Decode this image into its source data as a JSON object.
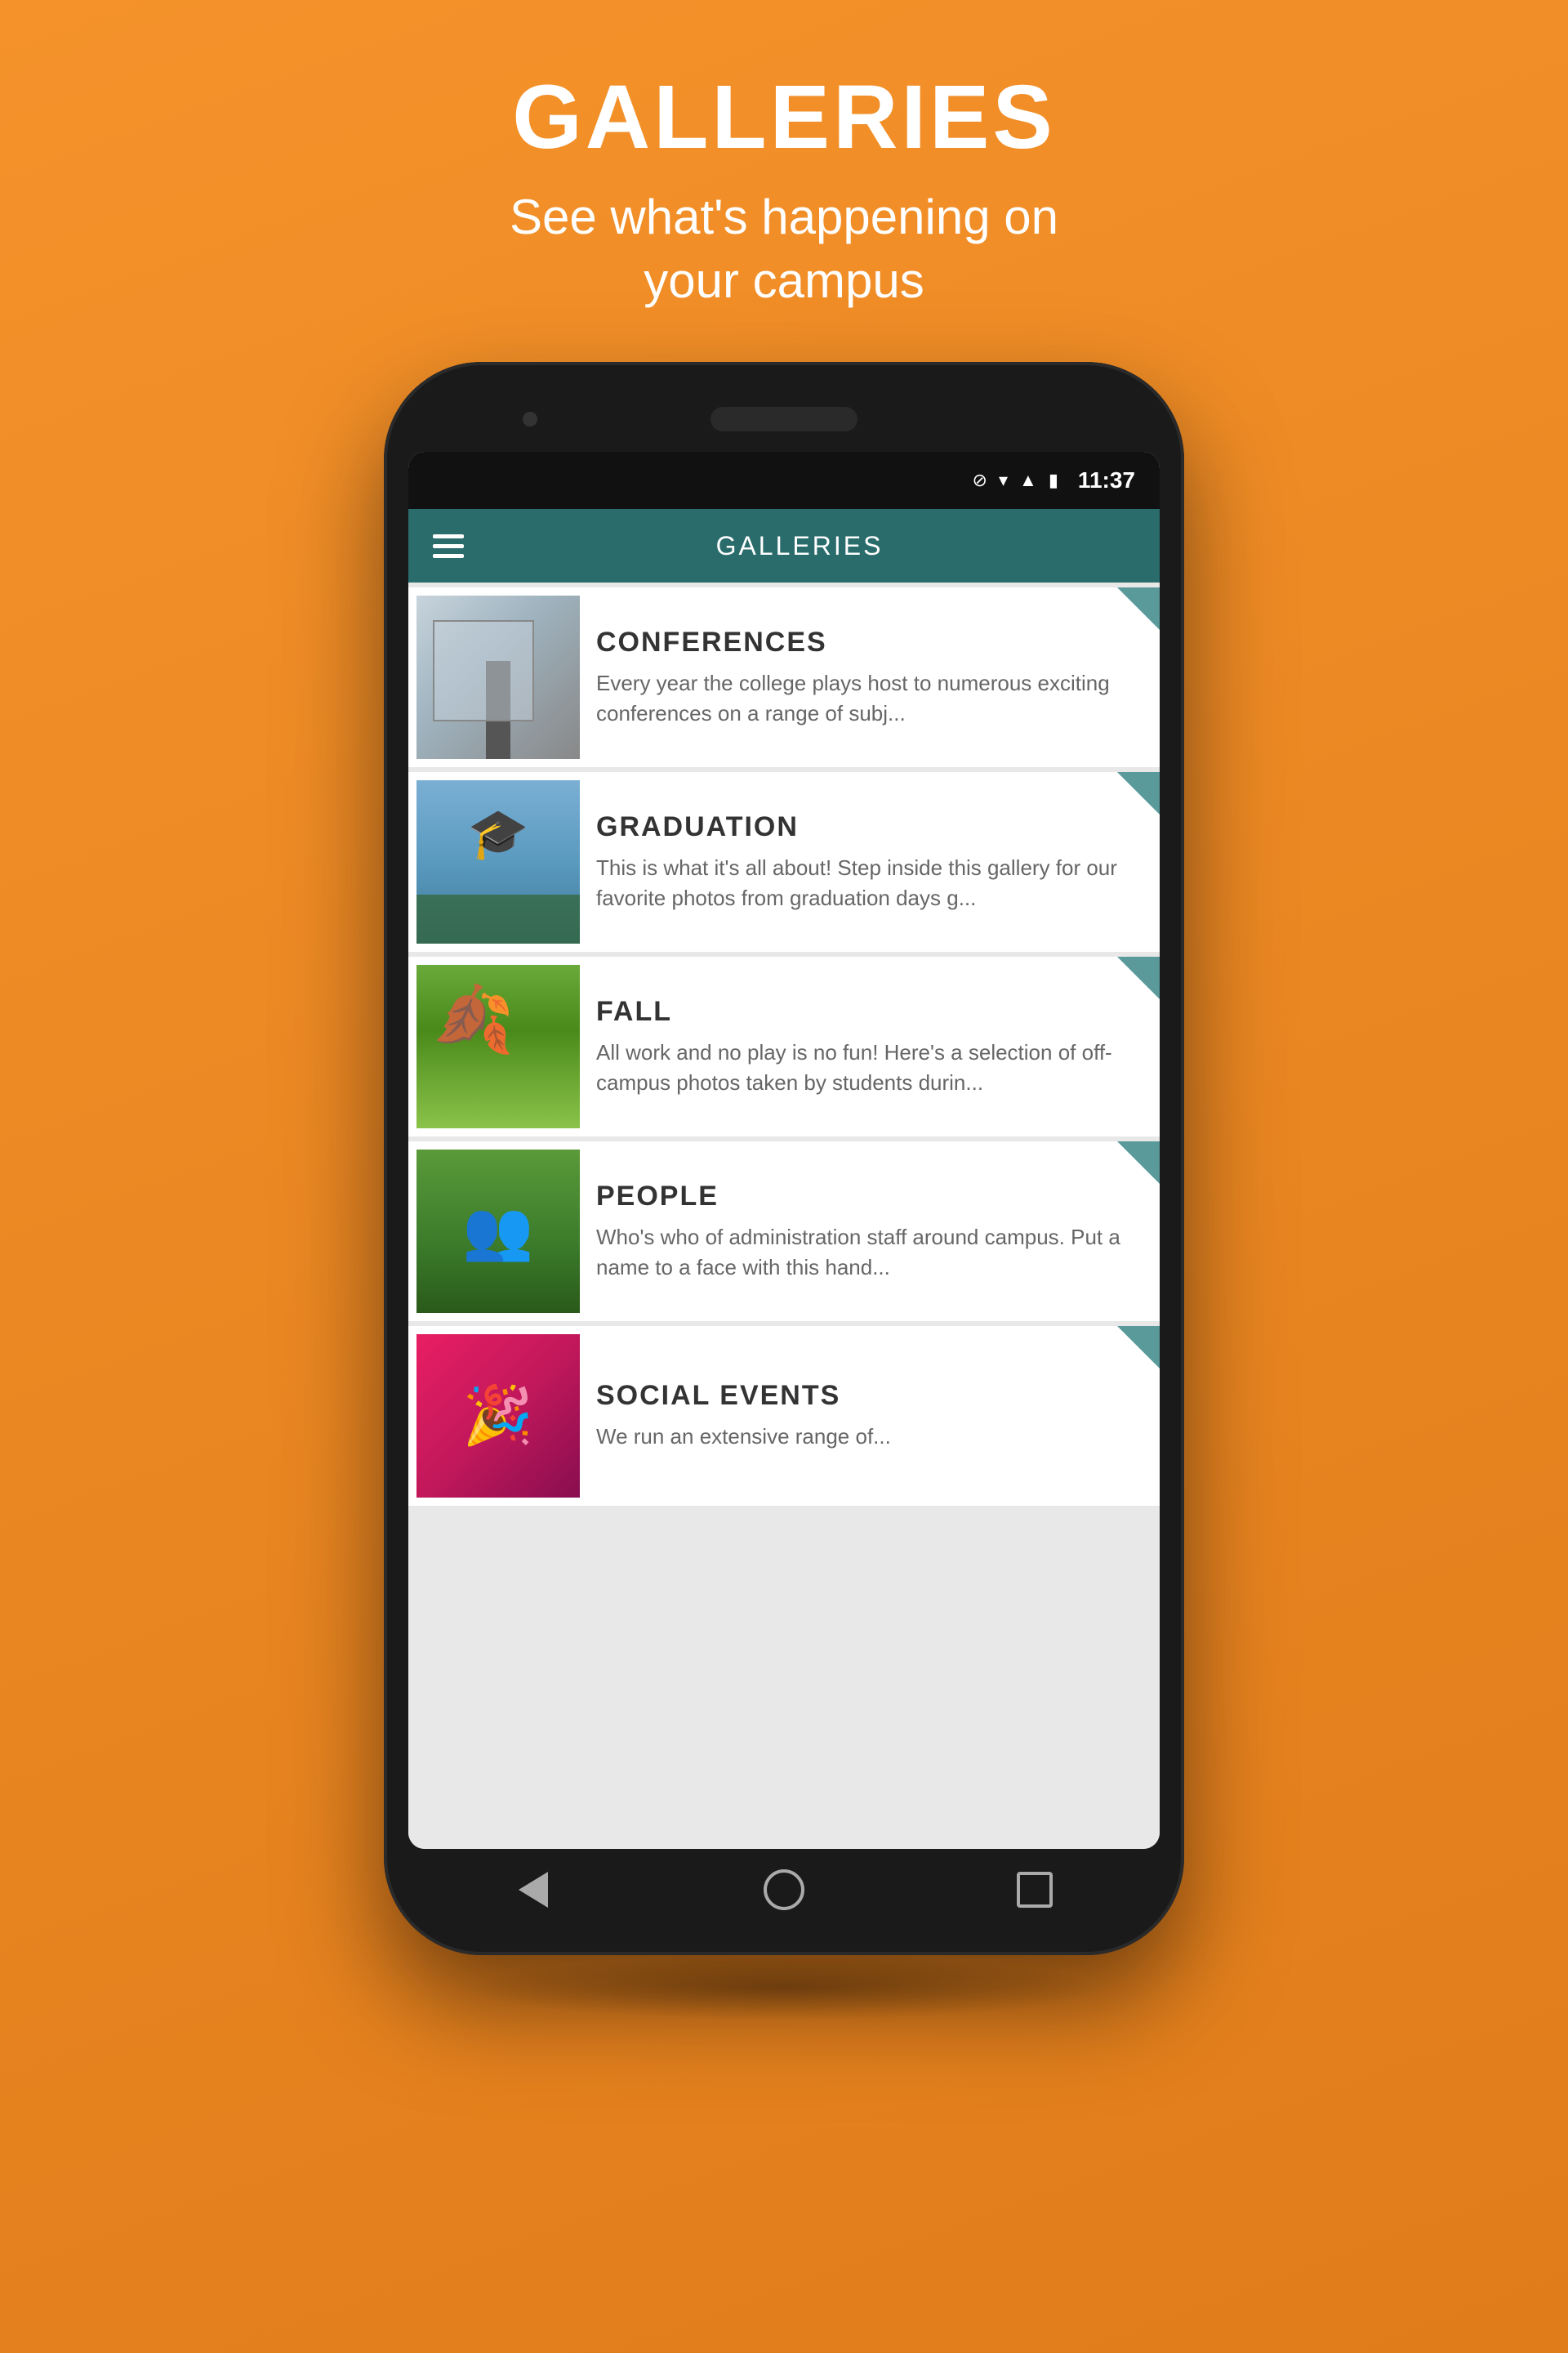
{
  "background_color": "#e87820",
  "header": {
    "title": "GALLERIES",
    "subtitle": "See what's happening on\nyour campus"
  },
  "phone": {
    "status_bar": {
      "time": "11:37",
      "icons": [
        "signal",
        "wifi",
        "battery"
      ]
    },
    "app_bar": {
      "title": "GALLERIES"
    },
    "gallery_items": [
      {
        "id": "conferences",
        "title": "CONFERENCES",
        "description": "Every year the college plays host to numerous exciting conferences on a range of subj...",
        "image_type": "conferences"
      },
      {
        "id": "graduation",
        "title": "GRADUATION",
        "description": "This is what it's all about!  Step inside this gallery for our favorite photos from graduation days g...",
        "image_type": "graduation"
      },
      {
        "id": "fall",
        "title": "FALL",
        "description": "All work and no play is no fun! Here's a selection of off-campus photos taken by students durin...",
        "image_type": "fall"
      },
      {
        "id": "people",
        "title": "PEOPLE",
        "description": "Who's who of administration staff around campus.  Put a name to a face with this hand...",
        "image_type": "people"
      },
      {
        "id": "social-events",
        "title": "SOCIAL EVENTS",
        "description": "We run an extensive range of...",
        "image_type": "social"
      }
    ],
    "nav": {
      "back_label": "back",
      "home_label": "home",
      "recents_label": "recents"
    }
  },
  "colors": {
    "background": "#e87820",
    "app_bar": "#2a6b6b",
    "arrow_accent": "#5a9a9a",
    "status_bar": "#111111"
  }
}
